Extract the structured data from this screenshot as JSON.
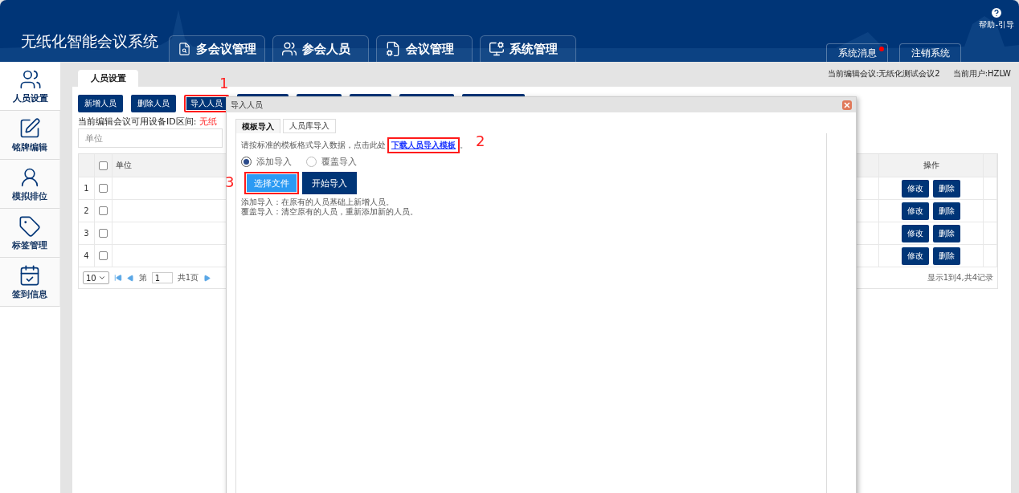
{
  "app_title": "无纸化智能会议系统",
  "nav_tabs": [
    {
      "label": "多会议管理"
    },
    {
      "label": "参会人员"
    },
    {
      "label": "会议管理"
    },
    {
      "label": "系统管理"
    }
  ],
  "help": {
    "label": "帮助-引导"
  },
  "header_buttons": [
    {
      "label": "系统消息",
      "unread": true
    },
    {
      "label": "注销系统",
      "unread": false
    }
  ],
  "sidebar": {
    "items": [
      {
        "label": "人员设置",
        "selected": true
      },
      {
        "label": "铭牌编辑",
        "selected": false
      },
      {
        "label": "模拟排位",
        "selected": false
      },
      {
        "label": "标签管理",
        "selected": false
      },
      {
        "label": "签到信息",
        "selected": false
      }
    ]
  },
  "page_tab": {
    "label": "人员设置"
  },
  "status": {
    "meeting": "当前编辑会议:无纸化测试会议2",
    "user": "当前用户:HZLW"
  },
  "toolbar": [
    {
      "label": "新增人员",
      "annotated": false
    },
    {
      "label": "删除人员",
      "annotated": false
    },
    {
      "label": "导入人员",
      "annotated": true,
      "annotation": "1"
    }
  ],
  "device_range": {
    "label": "当前编辑会议可用设备ID区间:",
    "value": "无纸"
  },
  "filter": {
    "placeholder": "单位"
  },
  "table": {
    "columns": [
      "单位",
      "操作"
    ],
    "all_checked": false,
    "rows": [
      {
        "index": "1",
        "checked": false,
        "actions": [
          "修改",
          "删除"
        ]
      },
      {
        "index": "2",
        "checked": false,
        "actions": [
          "修改",
          "删除"
        ]
      },
      {
        "index": "3",
        "checked": false,
        "actions": [
          "修改",
          "删除"
        ]
      },
      {
        "index": "4",
        "checked": false,
        "actions": [
          "修改",
          "删除"
        ]
      }
    ],
    "pager": {
      "page_size": "10",
      "page_prefix": "第",
      "page": "1",
      "total_pages": "共1页",
      "summary": "显示1到4,共4记录"
    }
  },
  "dialog": {
    "title": "导入人员",
    "tabs": [
      {
        "label": "模板导入",
        "selected": true
      },
      {
        "label": "人员库导入",
        "selected": false
      }
    ],
    "instruction": "请按标准的模板格式导入数据，点击此处",
    "link": {
      "label": "下载人员导入模板",
      "annotated": true,
      "annotation": "2"
    },
    "link_suffix": "。",
    "modes": [
      {
        "label": "添加导入",
        "selected": true
      },
      {
        "label": "覆盖导入",
        "selected": false
      }
    ],
    "buttons": [
      {
        "label": "选择文件",
        "kind": "primary",
        "annotated": true,
        "annotation": "3"
      },
      {
        "label": "开始导入",
        "kind": "dark",
        "annotated": false
      }
    ],
    "notes": [
      "添加导入：在原有的人员基础上新增人员。",
      "覆盖导入：清空原有的人员，重新添加新的人员。"
    ]
  }
}
